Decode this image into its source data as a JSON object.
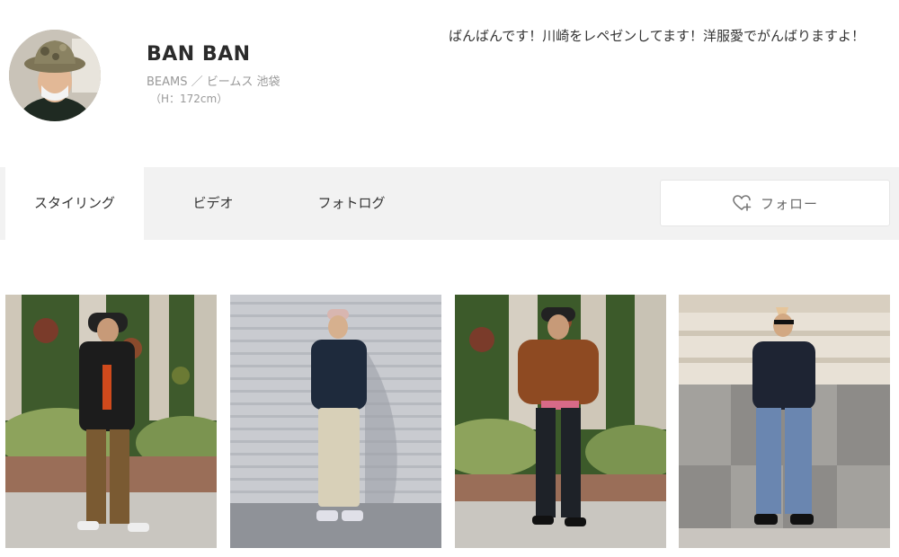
{
  "profile": {
    "name": "BAN BAN",
    "shop": "BEAMS ／ ビームス 池袋",
    "height": "（H：172cm）",
    "bio": "ばんばんです！川崎をレペゼンしてます！洋服愛でがんばりますよ！"
  },
  "tabs": [
    {
      "label": "スタイリング",
      "active": true
    },
    {
      "label": "ビデオ",
      "active": false
    },
    {
      "label": "フォトログ",
      "active": false
    }
  ],
  "follow": {
    "label": "フォロー",
    "icon": "heart-plus-icon"
  },
  "photos": [
    {
      "alt": "black hooded outfit, brown pants, green wall"
    },
    {
      "alt": "navy leather jacket, cream cargo pants, shutter"
    },
    {
      "alt": "brown puffer jacket, black pants, green wall"
    },
    {
      "alt": "navy jacket, distressed jeans, marble wall"
    }
  ],
  "colors": {
    "tabbar_bg": "#f2f2f2",
    "active_tab_bg": "#ffffff",
    "text": "#333333",
    "muted": "#9a9a9a"
  }
}
